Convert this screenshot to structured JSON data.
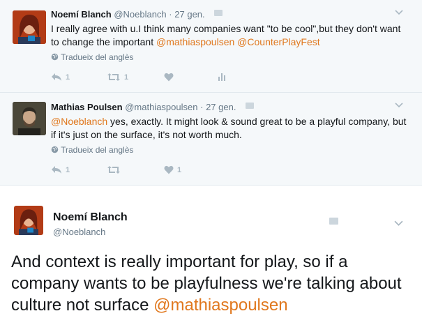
{
  "tweets": [
    {
      "fullname": "Noemí Blanch",
      "handle": "@Noeblanch",
      "separator": "·",
      "time": "27 gen.",
      "text_before": "I really agree with u.I think many companies want \"to be cool\",but they don't want to change the important ",
      "mention_1": "@mathiaspoulsen",
      "mention_2": "@CounterPlayFest",
      "translate": "Tradueix del anglès",
      "reply_count": "1",
      "retweet_count": "1"
    },
    {
      "fullname": "Mathias Poulsen",
      "handle": "@mathiaspoulsen",
      "separator": "·",
      "time": "27 gen.",
      "mention": "@Noeblanch",
      "text_after": " yes, exactly. It might look & sound great to be a playful company, but if it's just on the surface, it's not worth much.",
      "translate": "Tradueix del anglès",
      "reply_count": "1",
      "like_count": "1"
    }
  ],
  "expanded": {
    "fullname": "Noemí Blanch",
    "handle": "@Noeblanch",
    "text_before": "And context is really important for play, so if a company wants to be playfulness we're talking about culture not surface ",
    "mention": "@mathiaspoulsen"
  },
  "colors": {
    "accent": "#e0781e",
    "muted": "#657786",
    "icon": "#aab8c2",
    "bg_thread": "#f5f8fa"
  },
  "icons": {
    "reply": "reply-icon",
    "retweet": "retweet-icon",
    "like": "heart-icon",
    "analytics": "analytics-icon",
    "globe": "globe-icon",
    "more": "chevron-down-icon"
  }
}
